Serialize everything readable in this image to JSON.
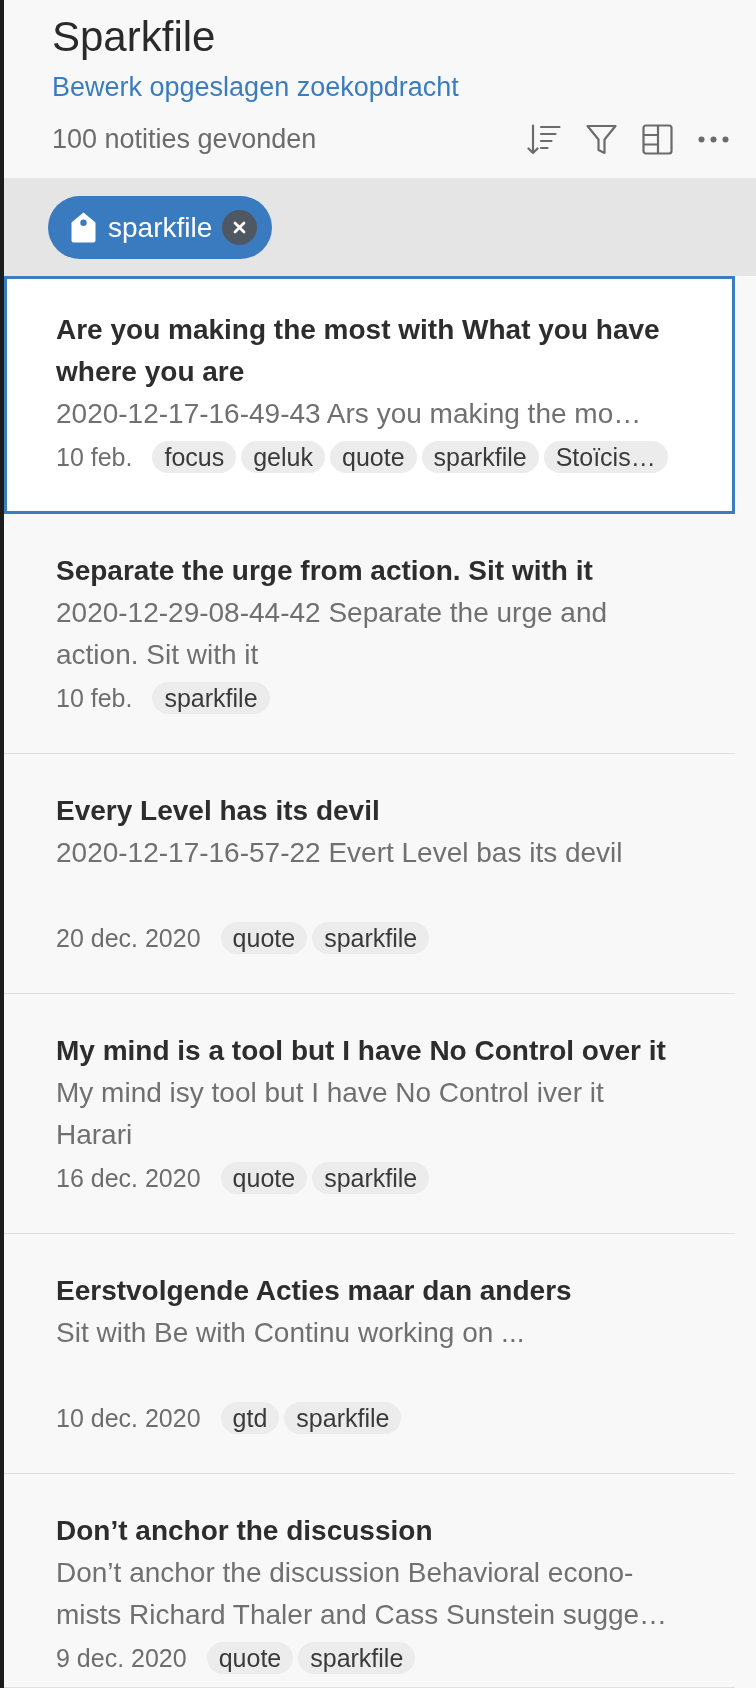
{
  "header": {
    "title": "Sparkfile",
    "edit_link": "Bewerk opgeslagen zoekopdracht",
    "result_count": "100 notities gevonden"
  },
  "filter_bar": {
    "tags": [
      {
        "label": "sparkfile"
      }
    ]
  },
  "notes": [
    {
      "title": "Are you making the most with What you have where you are",
      "snippet": "2020-12-17-16-49-43 Ars you making the mo…",
      "date": "10 feb.",
      "tags": [
        "focus",
        "geluk",
        "quote",
        "sparkfile",
        "Stoïcis…"
      ],
      "selected": true
    },
    {
      "title": "Separate the urge from action. Sit with it",
      "snippet": "2020-12-29-08-44-42 Separate the urge and action. Sit with it",
      "date": "10 feb.",
      "tags": [
        "sparkfile"
      ],
      "selected": false
    },
    {
      "title": "Every Level has its devil",
      "snippet": "2020-12-17-16-57-22 Evert Level bas its devil",
      "date": "20 dec. 2020",
      "tags": [
        "quote",
        "sparkfile"
      ],
      "selected": false
    },
    {
      "title": "My mind is a tool but I have No Control over it",
      "snippet": "My mind isy tool but I have No Control iver it Harari",
      "date": "16 dec. 2020",
      "tags": [
        "quote",
        "sparkfile"
      ],
      "selected": false
    },
    {
      "title": "Eerstvolgende Acties maar dan anders",
      "snippet": "Sit with Be with Continu working on ...",
      "date": "10 dec. 2020",
      "tags": [
        "gtd",
        "sparkfile"
      ],
      "selected": false
    },
    {
      "title": "Don’t anchor the discussion",
      "snippet": "Don’t anchor the discussion Behavioral econo-mists Richard Thaler and Cass Sunstein sugge…",
      "date": "9 dec. 2020",
      "tags": [
        "quote",
        "sparkfile"
      ],
      "selected": false
    }
  ]
}
